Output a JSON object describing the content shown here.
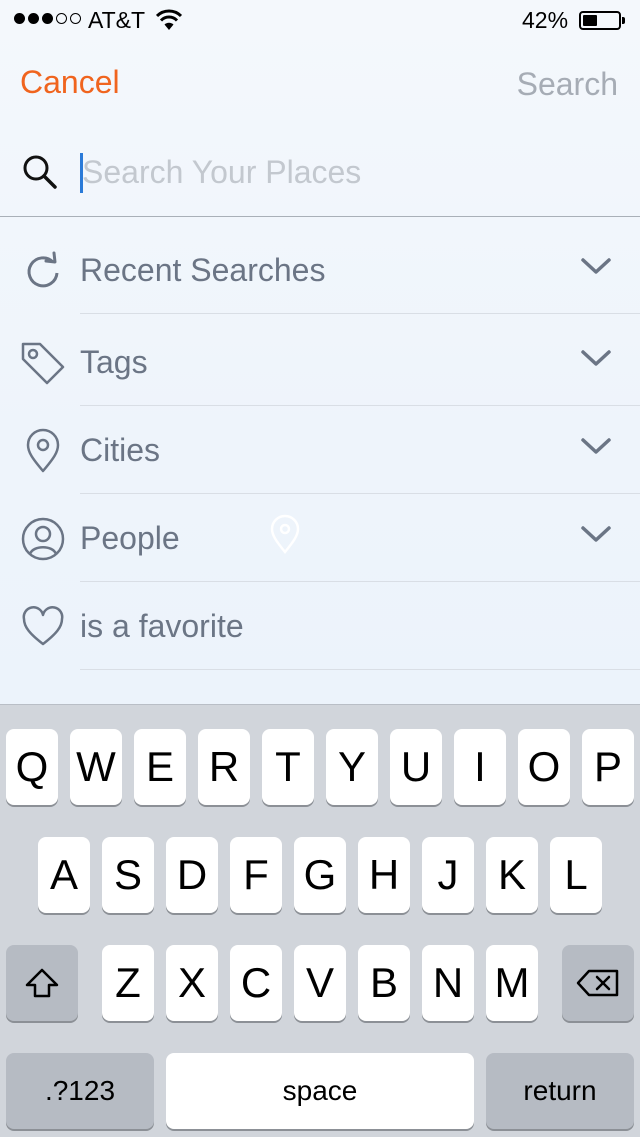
{
  "status_bar": {
    "carrier": "AT&T",
    "battery_pct": "42%",
    "battery_level": 0.42,
    "signal_bars": 3,
    "signal_total": 5
  },
  "nav": {
    "cancel_label": "Cancel",
    "search_label": "Search"
  },
  "search": {
    "placeholder": "Search Your Places"
  },
  "list": {
    "items": [
      {
        "label": "Recent Searches",
        "icon": "refresh-icon",
        "expandable": true
      },
      {
        "label": "Tags",
        "icon": "tag-icon",
        "expandable": true
      },
      {
        "label": "Cities",
        "icon": "location-pin-icon",
        "expandable": true
      },
      {
        "label": "People",
        "icon": "person-icon",
        "expandable": true
      },
      {
        "label": "is a favorite",
        "icon": "heart-icon",
        "expandable": false
      }
    ]
  },
  "keyboard": {
    "row1": [
      "Q",
      "W",
      "E",
      "R",
      "T",
      "Y",
      "U",
      "I",
      "O",
      "P"
    ],
    "row2": [
      "A",
      "S",
      "D",
      "F",
      "G",
      "H",
      "J",
      "K",
      "L"
    ],
    "row3": [
      "Z",
      "X",
      "C",
      "V",
      "B",
      "N",
      "M"
    ],
    "numbers_label": ".?123",
    "space_label": "space",
    "return_label": "return"
  },
  "colors": {
    "accent": "#f0641e",
    "text": "#6b7585",
    "placeholder": "#c3c8cf",
    "caret": "#2a7ad8"
  }
}
